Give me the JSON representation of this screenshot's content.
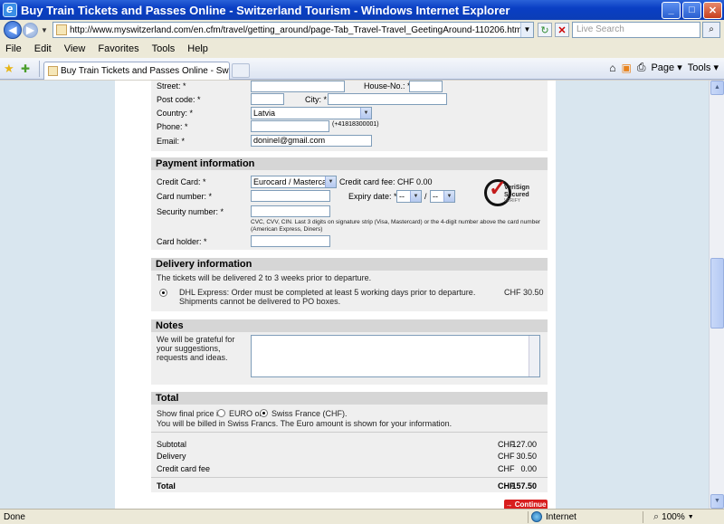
{
  "window": {
    "title": "Buy Train Tickets and Passes Online - Switzerland Tourism - Windows Internet Explorer",
    "minimize": "_",
    "maximize": "□",
    "close": "✕"
  },
  "address": {
    "url": "http://www.myswitzerland.com/en.cfm/travel/getting_around/page-Tab_Travel-Travel_GeetingAround-110206.html",
    "search_placeholder": "Live Search"
  },
  "menu": [
    "File",
    "Edit",
    "View",
    "Favorites",
    "Tools",
    "Help"
  ],
  "tab": {
    "label": "Buy Train Tickets and Passes Online - Switze..."
  },
  "command_bar": {
    "page": "Page",
    "tools": "Tools"
  },
  "address_section": {
    "street_label": "Street: *",
    "house_label": "House-No.: *",
    "postcode_label": "Post code: *",
    "city_label": "City: *",
    "country_label": "Country: *",
    "country_value": "Latvia",
    "phone_label": "Phone: *",
    "phone_hint": "(+41818300001)",
    "email_label": "Email: *",
    "email_value": "doninel@gmail.com"
  },
  "payment": {
    "heading": "Payment information",
    "card_label": "Credit Card: *",
    "card_value": "Eurocard / Mastercard",
    "card_fee": "Credit card fee: CHF 0.00",
    "number_label": "Card number: *",
    "expiry_label": "Expiry date: *",
    "expiry_month": "--",
    "expiry_sep": "/",
    "expiry_year": "--",
    "security_label": "Security number: *",
    "security_hint": "CVC, CVV, CIN. Last 3 digits on signature strip (Visa, Mastercard) or the 4-digit number above the card number (American Express, Diners)",
    "holder_label": "Card holder: *",
    "verisign_line1": "VeriSign",
    "verisign_line2": "Secured",
    "verisign_line3": "VERIFY"
  },
  "delivery": {
    "heading": "Delivery information",
    "note": "The tickets will be delivered 2 to 3 weeks prior to departure.",
    "option_text": "DHL Express: Order must be completed at least 5 working days prior to departure. Shipments cannot be delivered to PO boxes.",
    "option_price": "CHF 30.50"
  },
  "notes": {
    "heading": "Notes",
    "text": "We will be grateful for your suggestions, requests and ideas."
  },
  "total": {
    "heading": "Total",
    "show_price_prefix": "Show final price in",
    "euro_label": "EURO or",
    "chf_label": "Swiss France (CHF).",
    "billing_note": "You will be billed in Swiss Francs. The Euro amount is shown for your information.",
    "rows": [
      {
        "label": "Subtotal",
        "currency": "CHF",
        "amount": "127.00"
      },
      {
        "label": "Delivery",
        "currency": "CHF",
        "amount": "30.50"
      },
      {
        "label": "Credit card fee",
        "currency": "CHF",
        "amount": "0.00"
      }
    ],
    "total_label": "Total",
    "total_currency": "CHF",
    "total_amount": "157.50",
    "continue": "→ Continue"
  },
  "status": {
    "text": "Done",
    "zone": "Internet",
    "zoom": "100%"
  }
}
